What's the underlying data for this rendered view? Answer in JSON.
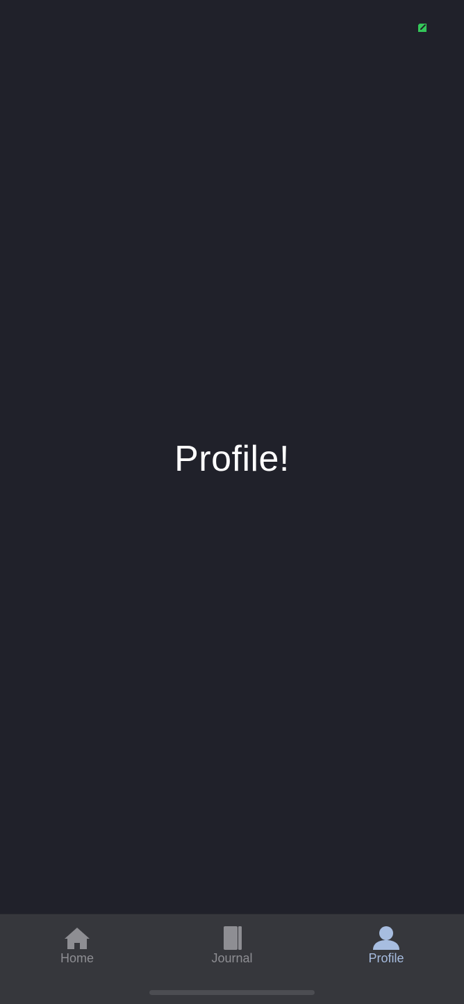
{
  "status": {
    "indicator_icon": "camera-in-use-indicator-icon",
    "indicator_color": "#34c759"
  },
  "main": {
    "title": "Profile!"
  },
  "tab_bar": {
    "active_tab": "Profile",
    "active_color": "#a7bde0",
    "inactive_color": "#8e8e93",
    "tabs": [
      {
        "label": "Home",
        "icon": "home-icon"
      },
      {
        "label": "Journal",
        "icon": "journal-icon"
      },
      {
        "label": "Profile",
        "icon": "person-icon"
      }
    ]
  }
}
